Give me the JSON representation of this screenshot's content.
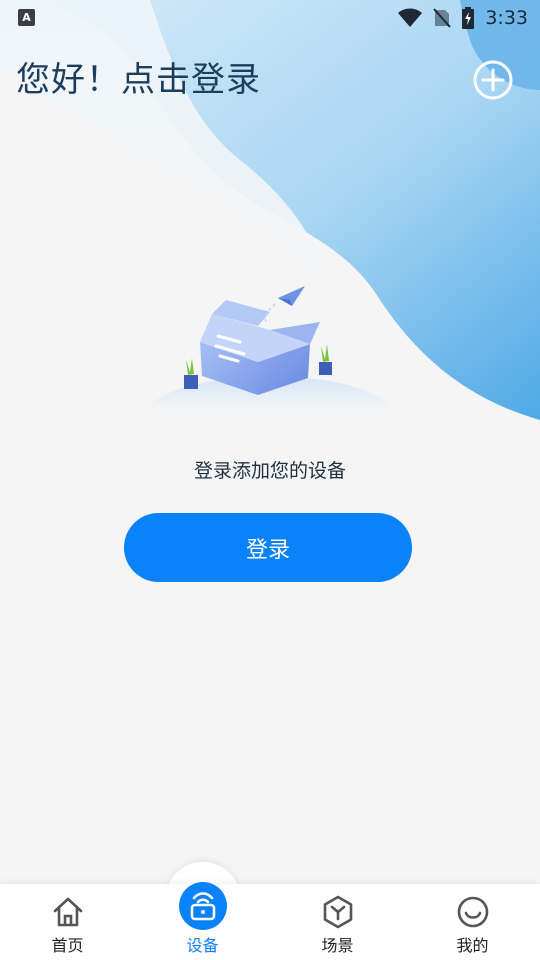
{
  "status_bar": {
    "left_icon": "A",
    "time": "3:33",
    "icons": [
      "wifi-icon",
      "no-sim-icon",
      "battery-charging-icon"
    ]
  },
  "header": {
    "greeting": "您好！点击登录",
    "add_icon": "plus-circle-icon"
  },
  "empty_state": {
    "illustration": "box-with-paper-plane-illustration",
    "message": "登录添加您的设备",
    "login_label": "登录"
  },
  "tab_bar": {
    "tabs": [
      {
        "label": "首页",
        "icon": "home-icon",
        "active": false
      },
      {
        "label": "设备",
        "icon": "router-icon",
        "active": true
      },
      {
        "label": "场景",
        "icon": "scene-hexagon-icon",
        "active": false
      },
      {
        "label": "我的",
        "icon": "smile-face-icon",
        "active": false
      }
    ]
  },
  "colors": {
    "accent": "#0a82fb",
    "greeting_text": "#1c3d5c",
    "background": "#f5f5f6",
    "wave_blue": "#5fb2e8"
  }
}
